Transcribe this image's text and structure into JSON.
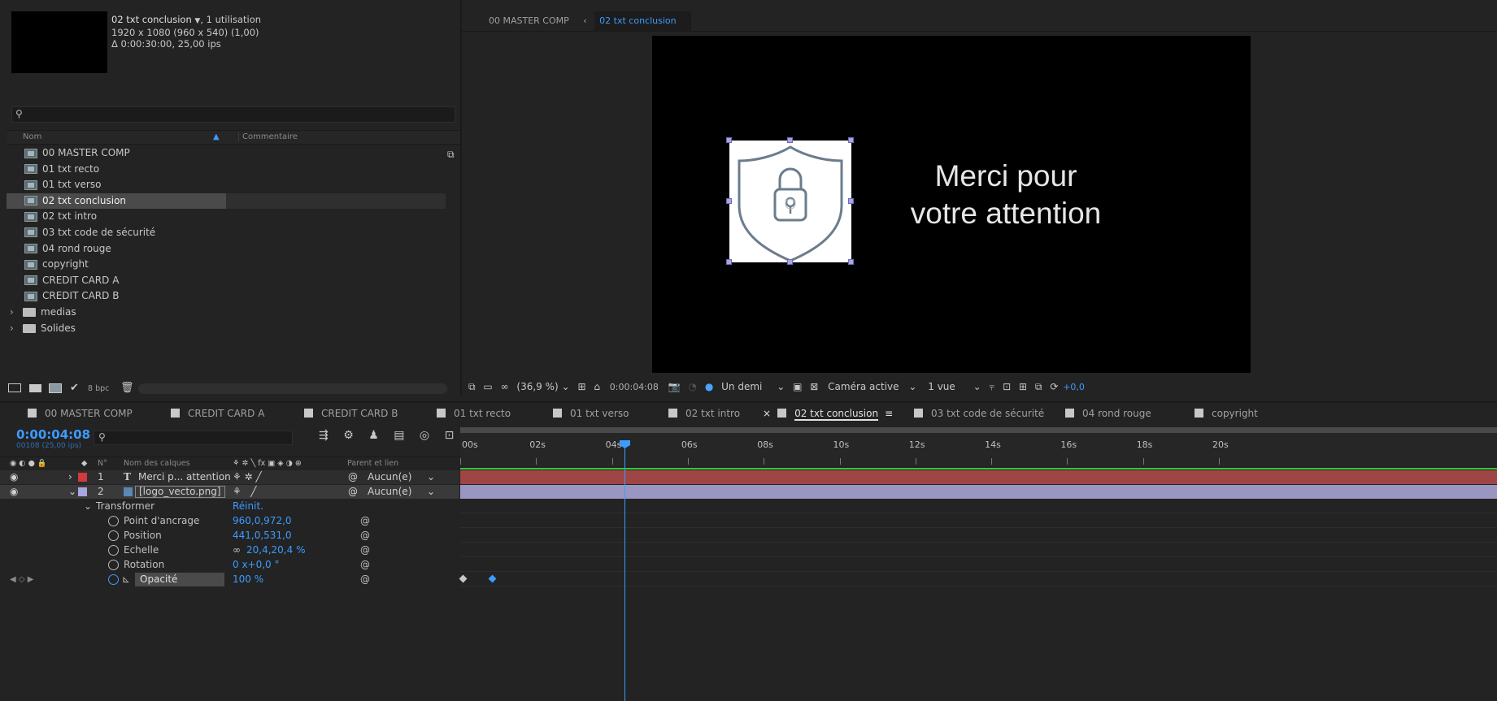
{
  "project": {
    "comp_name": "02 txt conclusion",
    "usage": ", 1 utilisation",
    "dims": "1920 x 1080  (960 x 540) (1,00)",
    "duration": "Δ 0:00:30:00, 25,00 ips",
    "search_placeholder": "",
    "col_name": "Nom",
    "col_comment": "Commentaire",
    "items": [
      {
        "label": "00 MASTER COMP",
        "type": "comp"
      },
      {
        "label": "01 txt recto",
        "type": "comp"
      },
      {
        "label": "01 txt verso",
        "type": "comp"
      },
      {
        "label": "02 txt conclusion",
        "type": "comp"
      },
      {
        "label": "02 txt intro",
        "type": "comp"
      },
      {
        "label": "03 txt code de sécurité",
        "type": "comp"
      },
      {
        "label": "04 rond rouge",
        "type": "comp"
      },
      {
        "label": "copyright",
        "type": "comp"
      },
      {
        "label": "CREDIT CARD A",
        "type": "comp"
      },
      {
        "label": "CREDIT CARD B",
        "type": "comp"
      },
      {
        "label": "medias",
        "type": "folder"
      },
      {
        "label": "Solides",
        "type": "folder"
      }
    ],
    "bpc": "8 bpc"
  },
  "viewer": {
    "breadcrumb_root": "00 MASTER COMP",
    "breadcrumb_current": "02 txt conclusion",
    "canvas_text_line1": "Merci pour",
    "canvas_text_line2": "votre attention",
    "zoom": "(36,9 %)",
    "timecode": "0:00:04:08",
    "resolution": "Un demi",
    "camera": "Caméra active",
    "views": "1 vue",
    "exposure": "+0,0"
  },
  "timeline": {
    "tabs": [
      {
        "label": "00 MASTER COMP",
        "color": "#c8c8c8"
      },
      {
        "label": "CREDIT CARD A",
        "color": "#c8c8c8"
      },
      {
        "label": "CREDIT CARD B",
        "color": "#c8c8c8"
      },
      {
        "label": "01 txt recto",
        "color": "#c8c8c8"
      },
      {
        "label": "01 txt verso",
        "color": "#c8c8c8"
      },
      {
        "label": "02 txt intro",
        "color": "#c8c8c8"
      },
      {
        "label": "02 txt conclusion",
        "color": "#c8c8c8"
      },
      {
        "label": "03 txt code de sécurité",
        "color": "#c8c8c8"
      },
      {
        "label": "04 rond rouge",
        "color": "#c8c8c8"
      },
      {
        "label": "copyright",
        "color": "#c8c8c8"
      }
    ],
    "current_time": "0:00:04:08",
    "frame_info": "00108 (25,00 ips)",
    "col_num": "N°",
    "col_layer_name": "Nom des calques",
    "col_parent": "Parent et lien",
    "ruler": [
      "00s",
      "02s",
      "04s",
      "06s",
      "08s",
      "10s",
      "12s",
      "14s",
      "16s",
      "18s",
      "20s"
    ],
    "layers": [
      {
        "num": "1",
        "name": "Merci p... attention",
        "parent": "Aucun(e)",
        "color": "#d13a3a"
      },
      {
        "num": "2",
        "name": "[logo_vecto.png]",
        "parent": "Aucun(e)",
        "color": "#a9a6e0"
      }
    ],
    "transform_label": "Transformer",
    "reset_label": "Réinit.",
    "properties": [
      {
        "name": "Point d'ancrage",
        "value": "960,0,972,0"
      },
      {
        "name": "Position",
        "value": "441,0,531,0"
      },
      {
        "name": "Echelle",
        "value": "20,4,20,4 %"
      },
      {
        "name": "Rotation",
        "value": "0 x+0,0 °"
      },
      {
        "name": "Opacité",
        "value": "100 %"
      }
    ],
    "accent": "#3d9bff"
  }
}
